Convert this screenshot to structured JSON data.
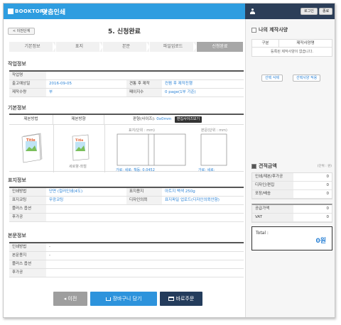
{
  "app": {
    "brand": "BOOKTORY",
    "title": "맞춤인쇄"
  },
  "top_buttons": {
    "login": "로그인",
    "logout": "종료"
  },
  "header": {
    "back_label": "< 이전단계",
    "step_title": "5. 신청완료"
  },
  "steps": [
    "기본정보",
    "표지",
    "본문",
    "파일업로드",
    "신청완료"
  ],
  "active_step_index": 4,
  "work_info": {
    "title": "작업정보",
    "rows": [
      {
        "label": "작업명",
        "value": ""
      },
      {
        "label": "출고예상일",
        "value": "2016-09-05",
        "label2": "견통 후 제작",
        "value2": "컨펌 후 제작진행"
      },
      {
        "label": "제작수량",
        "value": "부",
        "label2": "페이지수",
        "value2": "0 page(1부 기준)"
      }
    ]
  },
  "basic_info": {
    "title": "기본정보",
    "head_method": "제본방법",
    "head_direction": "제본방향",
    "head_size": "판형(사이즈):",
    "size_value": "0x0mm",
    "size_button": "편집사이즈보기",
    "direction_label": "세로향-좌철",
    "cover_unit": "표지(단위 : mm)",
    "body_unit": "본문(단위 : mm)",
    "cover_dims": "가로:  세로:  책등: 0.0452",
    "body_dims": "가로:  세로:",
    "book_text": "Title"
  },
  "cover_info": {
    "title": "표지정보",
    "rows": [
      {
        "label": "인쇄방법",
        "value": "단면 (컬러인쇄(4도)",
        "label2": "표지용지",
        "value2": "아트지 백색 250g"
      },
      {
        "label": "표지코팅",
        "value": "무광코팅",
        "label2": "디자인의뢰",
        "value2": "표지파일 업로드(디자인의뢰안함)"
      },
      {
        "label": "플러스 옵션",
        "value": ""
      },
      {
        "label": "후가공",
        "value": ""
      }
    ]
  },
  "body_info": {
    "title": "본문정보",
    "rows": [
      {
        "label": "인쇄방법",
        "value": "-"
      },
      {
        "label": "본문용지",
        "value": "-"
      },
      {
        "label": "플러스 옵션",
        "value": ""
      },
      {
        "label": "후가공",
        "value": ""
      }
    ]
  },
  "buttons": {
    "prev": "◂ 이전",
    "cart": "장바구니 담기",
    "order": "바로주문"
  },
  "sidebar": {
    "my_specs_title": "나의 제작사양",
    "table_head_left": "구분",
    "table_head_right": "제작사양명",
    "empty_text": "등록된 제작사양이 없습니다.",
    "btn_delete": "선택 삭제",
    "btn_apply": "선택사양 적용",
    "estimate_title": "견적금액",
    "unit_note": "(단위 : 원)",
    "price_rows": [
      {
        "label": "인쇄/제본/후가공",
        "value": "0"
      },
      {
        "label": "디자인/편집",
        "value": "0"
      },
      {
        "label": "포장/배송",
        "value": "0"
      }
    ],
    "tax_rows": [
      {
        "label": "공급가액",
        "value": "0"
      },
      {
        "label": "VAT",
        "value": "0"
      }
    ],
    "total_label": "Total :",
    "total_value": "0원"
  },
  "colors": {
    "brand_blue": "#2e9de0",
    "sidebar_dark": "#2c3e58",
    "link_blue": "#2e84d6",
    "btn_gray": "#9e9e9e",
    "btn_blue": "#2d93dc",
    "btn_navy": "#243c5c"
  }
}
